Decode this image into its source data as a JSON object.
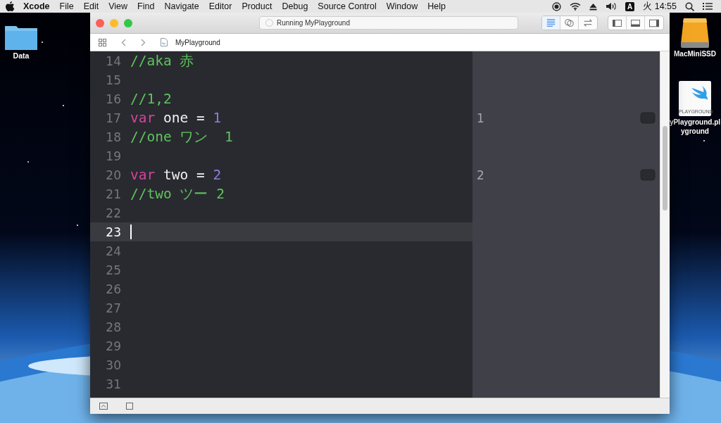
{
  "menubar": {
    "app": "Xcode",
    "menus": [
      "File",
      "Edit",
      "View",
      "Find",
      "Navigate",
      "Editor",
      "Product",
      "Debug",
      "Source Control",
      "Window",
      "Help"
    ],
    "input_source": "A",
    "clock": "火 14:55"
  },
  "desktop_icons": [
    {
      "kind": "folder",
      "lines": [
        "Data"
      ]
    },
    {
      "kind": "drive",
      "lines": [
        "MacMiniSSD"
      ]
    },
    {
      "kind": "playground",
      "badge": "PLAYGROUND",
      "lines": [
        "yPlayground.pl",
        "yground"
      ]
    }
  ],
  "window": {
    "title": "Running MyPlayground",
    "breadcrumb": "MyPlayground",
    "editor_modes": [
      {
        "kind": "standard",
        "selected": true
      },
      {
        "kind": "assistant",
        "selected": false
      },
      {
        "kind": "version",
        "selected": false
      }
    ],
    "lines": [
      {
        "number": "14",
        "current": false,
        "tokens": [
          {
            "kind": "comment",
            "text": "//aka 赤"
          }
        ]
      },
      {
        "number": "15",
        "current": false
      },
      {
        "number": "16",
        "current": false,
        "tokens": [
          {
            "kind": "comment",
            "text": "//1,2"
          }
        ]
      },
      {
        "number": "17",
        "current": false,
        "result": "1",
        "tokens": [
          {
            "kind": "keyword",
            "text": "var"
          },
          {
            "kind": "plain",
            "text": " one = "
          },
          {
            "kind": "number",
            "text": "1"
          }
        ]
      },
      {
        "number": "18",
        "current": false,
        "tokens": [
          {
            "kind": "comment",
            "text": "//one ワン  1"
          }
        ]
      },
      {
        "number": "19",
        "current": false
      },
      {
        "number": "20",
        "current": false,
        "result": "2",
        "tokens": [
          {
            "kind": "keyword",
            "text": "var"
          },
          {
            "kind": "plain",
            "text": " two = "
          },
          {
            "kind": "number",
            "text": "2"
          }
        ]
      },
      {
        "number": "21",
        "current": false,
        "tokens": [
          {
            "kind": "comment",
            "text": "//two ツー 2"
          }
        ]
      },
      {
        "number": "22",
        "current": false
      },
      {
        "number": "23",
        "current": true
      },
      {
        "number": "24",
        "current": false
      },
      {
        "number": "25",
        "current": false
      },
      {
        "number": "26",
        "current": false
      },
      {
        "number": "27",
        "current": false
      },
      {
        "number": "28",
        "current": false
      },
      {
        "number": "29",
        "current": false
      },
      {
        "number": "30",
        "current": false
      },
      {
        "number": "31",
        "current": false
      }
    ]
  }
}
